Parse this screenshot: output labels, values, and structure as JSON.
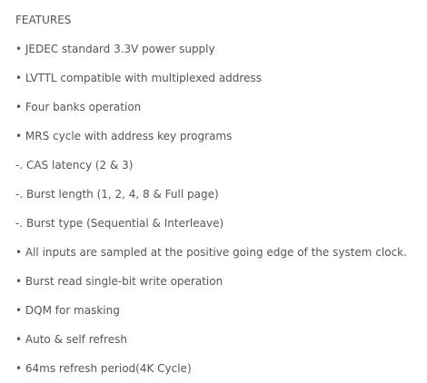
{
  "features": {
    "heading": "FEATURES",
    "items": [
      "• JEDEC standard 3.3V power supply",
      "• LVTTL compatible with multiplexed address",
      "• Four banks operation",
      "• MRS cycle with address key programs",
      "-. CAS latency (2 & 3)",
      "-. Burst length (1, 2, 4, 8 & Full page)",
      "-. Burst type (Sequential & Interleave)",
      "• All inputs are sampled at the positive going edge of the system clock.",
      "• Burst read single-bit write operation",
      "• DQM for masking",
      "• Auto & self refresh",
      "• 64ms refresh period(4K Cycle)"
    ]
  }
}
